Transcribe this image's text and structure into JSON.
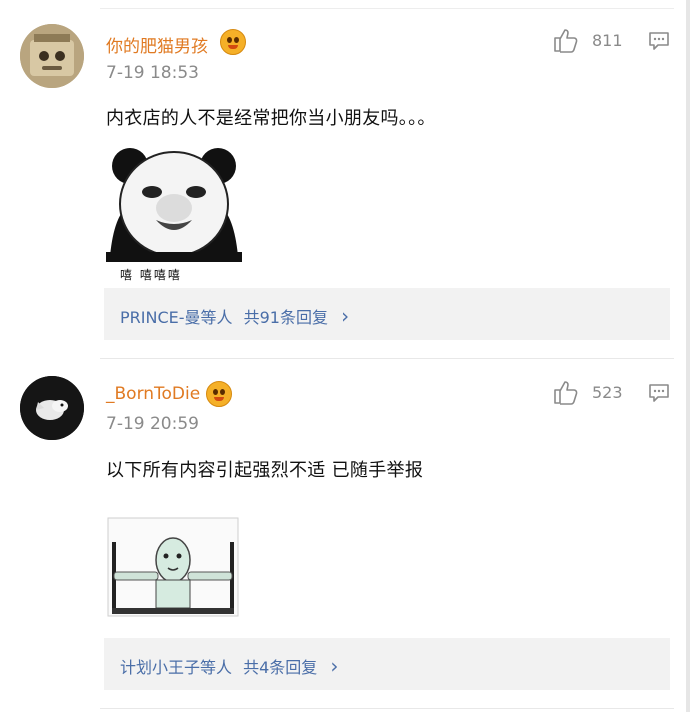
{
  "comments": [
    {
      "username": "你的肥猫男孩",
      "time": "7-19 18:53",
      "likes": "811",
      "text": "内衣店的人不是经常把你当小朋友吗。。。",
      "sticker_caption": "嘻  嘻嘻嘻",
      "reply_names": "PRINCE-曼等人",
      "reply_count": "共91条回复",
      "reply_arrow": "›"
    },
    {
      "username": "_BornToDie",
      "time": "7-19 20:59",
      "likes": "523",
      "text": "以下所有内容引起强烈不适 已随手举报",
      "reply_names": "计划小王子等人",
      "reply_count": "共4条回复",
      "reply_arrow": "›"
    }
  ],
  "colors": {
    "username": "#e07a22",
    "reply_link": "#4a6ea8",
    "meta": "#8a8a8a"
  },
  "icons": [
    "thumbs-up-icon",
    "reply-bubble-icon",
    "vip-emoji-badge-icon"
  ]
}
